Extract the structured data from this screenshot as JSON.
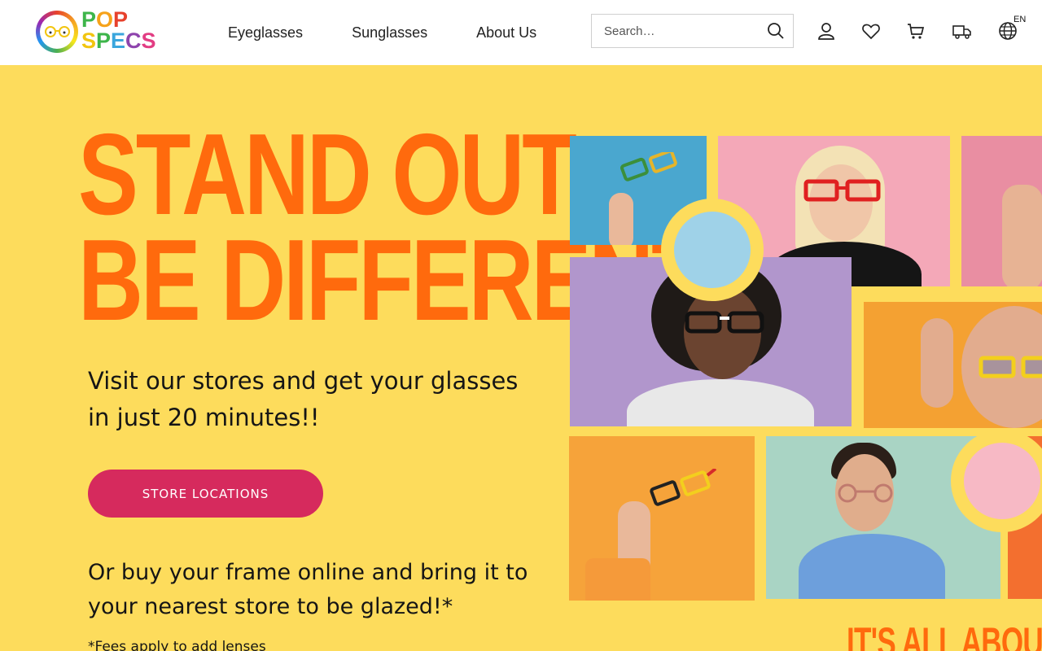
{
  "brand": {
    "logo_line1": "POP",
    "logo_line2": "SPECS"
  },
  "nav": {
    "items": [
      "Eyeglasses",
      "Sunglasses",
      "About Us"
    ]
  },
  "search": {
    "placeholder": "Search…"
  },
  "header_icons": [
    "user-icon",
    "heart-icon",
    "cart-icon",
    "delivery-truck-icon",
    "globe-icon"
  ],
  "language": {
    "code": "EN"
  },
  "hero": {
    "headline_line1": "STAND OUT.",
    "headline_line2": "BE DIFFERENT.",
    "subtitle": "Visit our stores and get your glasses in just 20 minutes!!",
    "cta_label": "STORE LOCATIONS",
    "online_text": "Or buy your frame online and bring it to your nearest store to be glazed!*",
    "fees_note": "*Fees apply to add lenses",
    "tagline": "IT'S ALL ABOUT Y"
  },
  "colors": {
    "hero_bg": "#fddc5c",
    "headline": "#ff6a0d",
    "cta": "#d62a5d"
  }
}
